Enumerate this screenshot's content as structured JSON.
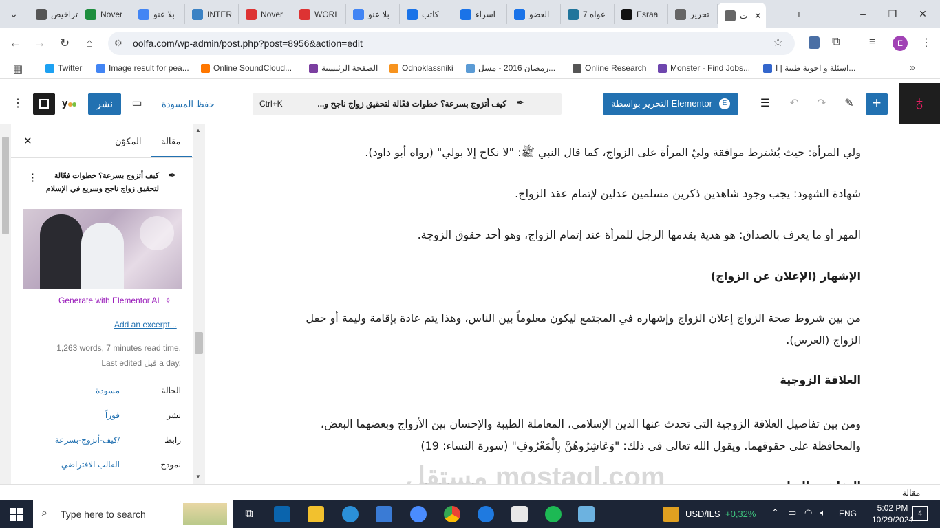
{
  "browser": {
    "tabs": [
      {
        "label": "تراخيص",
        "fav": "#555"
      },
      {
        "label": "Nover",
        "fav": "#1e8e3e"
      },
      {
        "label": "بلا عنو",
        "fav": "#4285f4"
      },
      {
        "label": "INTER",
        "fav": "#3b82c4"
      },
      {
        "label": "Nover",
        "fav": "#d33"
      },
      {
        "label": "WORL",
        "fav": "#d33"
      },
      {
        "label": "بلا عنو",
        "fav": "#4285f4"
      },
      {
        "label": "كاتب",
        "fav": "#1a73e8"
      },
      {
        "label": "اسراء",
        "fav": "#1a73e8"
      },
      {
        "label": "العضو",
        "fav": "#1a73e8"
      },
      {
        "label": "7 عواه",
        "fav": "#21759b"
      },
      {
        "label": "Esraa",
        "fav": "#111"
      },
      {
        "label": "تحرير",
        "fav": "#666"
      },
      {
        "label": "ت",
        "fav": "#666"
      }
    ],
    "new_tab": "+",
    "url": "oolfa.com/wp-admin/post.php?post=8956&action=edit",
    "profile_initial": "E",
    "bookmarks": [
      {
        "label": "Twitter",
        "color": "#1da1f2"
      },
      {
        "label": "Image result for pea...",
        "color": "#4285f4"
      },
      {
        "label": "Online SoundCloud...",
        "color": "#ff7700"
      },
      {
        "label": "الصفحة الرئيسية",
        "color": "#7b3fa0"
      },
      {
        "label": "Odnoklassniki",
        "color": "#f7931e"
      },
      {
        "label": "رمضان 2016 - مسل...",
        "color": "#5b9bd5"
      },
      {
        "label": "Online Research",
        "color": "#555"
      },
      {
        "label": "Monster - Find Jobs...",
        "color": "#6e46ae"
      },
      {
        "label": "اسئلة و اجوبة طبية | ا...",
        "color": "#3366cc"
      }
    ]
  },
  "wp_toolbar": {
    "elementor_label": "التحرير بواسطة Elementor",
    "doc_title": "كيف أتزوج بسرعة؟ خطوات فعّالة لتحقيق زواج ناجح و...",
    "shortcut": "Ctrl+K",
    "save_draft": "حفظ المسودة",
    "publish": "نشر",
    "brand_color": "#2271b1"
  },
  "sidebar": {
    "tab_post": "مقالة",
    "tab_block": "المكوّن",
    "title_line1": "كيف أتزوج بسرعة؟ خطوات فعّالة",
    "title_line2": "لتحقيق زواج ناجح وسريع في الإسلام",
    "generate_ai": "Generate with Elementor AI",
    "add_excerpt": "Add an excerpt...",
    "meta_line1": "1,263 words, 7 minutes read time.",
    "meta_line2": "Last edited قبل a day.",
    "rows": [
      {
        "label": "الحالة",
        "value": "مسودة"
      },
      {
        "label": "نشر",
        "value": "فوراً"
      },
      {
        "label": "رابط",
        "value": "/كيف-أتزوج-بسرعة"
      },
      {
        "label": "نموذج",
        "value": "القالب الافتراضي"
      }
    ]
  },
  "content": {
    "paragraphs": [
      {
        "text": "ولي المرأة: حيث يُشترط موافقة وليّ المرأة على الزواج، كما قال النبي ﷺ: \"لا نكاح إلا بولي\" (رواه أبو داود).",
        "heading": false
      },
      {
        "text": "شهادة الشهود: يجب وجود شاهدين ذكرين مسلمين عدلين لإتمام عقد الزواج.",
        "heading": false
      },
      {
        "text": "المهر أو ما يعرف بالصداق: هو هدية يقدمها الرجل للمرأة عند إتمام الزواج، وهو أحد حقوق الزوجة.",
        "heading": false
      },
      {
        "text": "الإشهار (الإعلان عن الزواج)",
        "heading": true
      },
      {
        "text": "من بين شروط صحة الزواج إعلان الزواج وإشهاره في المجتمع ليكون معلوماً بين الناس، وهذا يتم عادة بإقامة وليمة أو حفل الزواج (العرس).",
        "heading": false
      },
      {
        "text": "العلاقة الزوجية",
        "heading": true
      },
      {
        "text": "ومن بين تفاصيل العلاقة الزوجية التي تحدث عنها الدين الإسلامي، المعاملة الطيبة والإحسان بين الأزواج وبعضهما البعض، والمحافظة على حقوقهما. ويقول الله تعالى في ذلك: \"وَعَاشِرُوهُنَّ بِالْمَعْرُوفِ\" (سورة النساء: 19)",
        "heading": false
      },
      {
        "text": "التفاهم والتعاون",
        "heading": true
      }
    ]
  },
  "footer": {
    "breadcrumb": "مقالة"
  },
  "taskbar": {
    "search_placeholder": "Type here to search",
    "currency": "USD/ILS",
    "change": "+0,32%",
    "lang": "ENG",
    "time": "5:02 PM",
    "date": "10/29/2024",
    "notifications": "4",
    "watermark": "مستقل mostaql.com"
  }
}
